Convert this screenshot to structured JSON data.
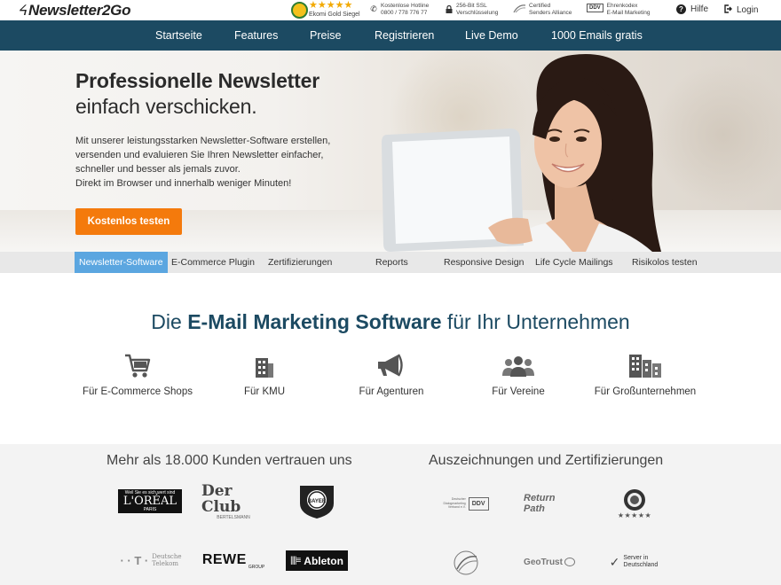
{
  "header": {
    "logo_text_1": "Newsletter",
    "logo_text_2": "2Go",
    "ekomi_stars": "★★★★★",
    "ekomi_label": "Ekomi Gold Siegel",
    "hotline_line1": "Kostenlose Hotline",
    "hotline_line2": "0800 / 778 776 77",
    "ssl_line1": "256-Bit SSL",
    "ssl_line2": "Verschlüsselung",
    "csa_line1": "Certified",
    "csa_line2": "Senders Alliance",
    "ddv_badge": "DDV",
    "ddv_line1": "Ehrenkodex",
    "ddv_line2": "E-Mail Marketing",
    "help_label": "Hilfe",
    "login_label": "Login"
  },
  "nav": {
    "items": [
      "Startseite",
      "Features",
      "Preise",
      "Registrieren",
      "Live Demo",
      "1000 Emails gratis"
    ]
  },
  "hero": {
    "title_bold": "Professionelle Newsletter",
    "title_light": "einfach verschicken.",
    "description_lines": [
      "Mit unserer leistungsstarken Newsletter-Software erstellen,",
      "versenden und evaluieren Sie Ihren Newsletter einfacher,",
      "schneller und besser als jemals zuvor.",
      "Direkt im Browser und innerhalb weniger Minuten!"
    ],
    "cta_label": "Kostenlos testen"
  },
  "subtabs": {
    "items": [
      "Newsletter-Software",
      "E-Commerce Plugin",
      "Zertifizierungen",
      "Reports",
      "Responsive Design",
      "Life Cycle Mailings",
      "Risikolos testen"
    ],
    "active_index": 0
  },
  "main": {
    "heading_pre": "Die ",
    "heading_bold": "E-Mail Marketing Software",
    "heading_post": " für Ihr Unternehmen",
    "categories": [
      {
        "label": "Für E-Commerce Shops",
        "icon": "shopping-cart-icon"
      },
      {
        "label": "Für KMU",
        "icon": "building-icon"
      },
      {
        "label": "Für Agenturen",
        "icon": "megaphone-icon"
      },
      {
        "label": "Für Vereine",
        "icon": "group-icon"
      },
      {
        "label": "Für Großunternehmen",
        "icon": "office-buildings-icon"
      }
    ]
  },
  "customers": {
    "heading": "Mehr als 18.000 Kunden vertrauen uns",
    "loreal_top": "Weil Sie es sich wert sind",
    "loreal": "L'ORÉAL",
    "loreal_sub": "PARIS",
    "derclub": "Der Club",
    "derclub_sub": "BERTELSMANN",
    "bayer": "BAYER",
    "telekom_1": "Deutsche",
    "telekom_2": "Telekom",
    "rewe": "REWE",
    "rewe_sub": "GROUP",
    "ableton": "Ableton"
  },
  "awards": {
    "heading": "Auszeichnungen und Zertifizierungen",
    "ddv_small_1": "Deutscher",
    "ddv_small_2": "Dialogmarketing",
    "ddv_small_3": "Verband e.V.",
    "ddv_badge": "DDV",
    "returnpath": "Return Path",
    "ekomi_stars": "★★★★★",
    "geotrust": "GeoTrust",
    "server_1": "Server in",
    "server_2": "Deutschland"
  },
  "colors": {
    "nav_bg": "#1c4a62",
    "cta_bg": "#f47a0c",
    "active_tab_bg": "#5ba6e0",
    "heading_color": "#1c4a62"
  }
}
